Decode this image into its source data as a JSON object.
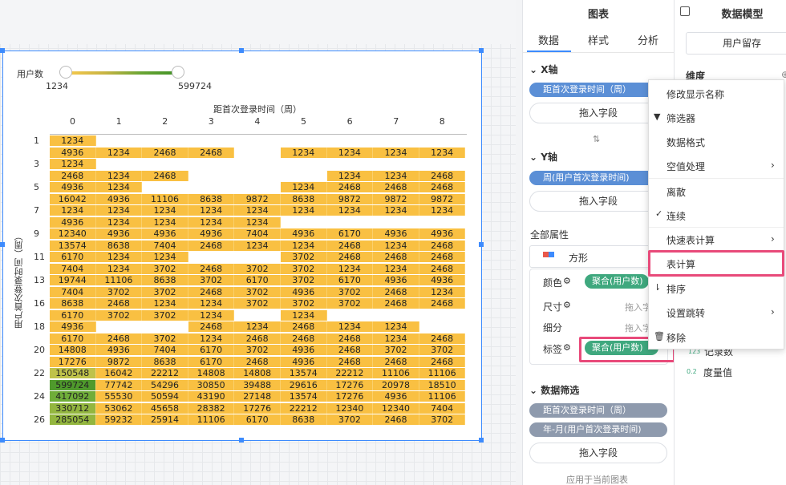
{
  "legend": {
    "title": "用户数",
    "min": "1234",
    "max": "599724"
  },
  "chart": {
    "x_title": "距首次登录时间（周）",
    "y_title": "用户首次登录时间（周）",
    "col_headers": [
      "0",
      "1",
      "2",
      "3",
      "4",
      "5",
      "6",
      "7",
      "8"
    ],
    "row_headers": [
      "1",
      "3",
      "5",
      "7",
      "9",
      "11",
      "13",
      "16",
      "18",
      "20",
      "22",
      "24",
      "26"
    ]
  },
  "chart_data": {
    "type": "heatmap",
    "columns": [
      "0",
      "1",
      "2",
      "3",
      "4",
      "5",
      "6",
      "7",
      "8"
    ],
    "rows": [
      [
        "1234",
        "",
        "",
        "",
        "",
        "",
        "",
        "",
        ""
      ],
      [
        "4936",
        "1234",
        "2468",
        "2468",
        "",
        "1234",
        "1234",
        "1234",
        "1234"
      ],
      [
        "1234",
        "",
        "",
        "",
        "",
        "",
        "",
        "",
        ""
      ],
      [
        "2468",
        "1234",
        "2468",
        "",
        "",
        "",
        "1234",
        "1234",
        "2468"
      ],
      [
        "4936",
        "1234",
        "",
        "",
        "",
        "1234",
        "2468",
        "2468",
        "2468"
      ],
      [
        "16042",
        "4936",
        "11106",
        "8638",
        "9872",
        "8638",
        "9872",
        "9872",
        "9872"
      ],
      [
        "1234",
        "1234",
        "1234",
        "1234",
        "1234",
        "1234",
        "1234",
        "1234",
        "1234"
      ],
      [
        "4936",
        "1234",
        "1234",
        "1234",
        "1234",
        "",
        "",
        "",
        ""
      ],
      [
        "12340",
        "4936",
        "4936",
        "4936",
        "7404",
        "4936",
        "6170",
        "4936",
        "4936"
      ],
      [
        "13574",
        "8638",
        "7404",
        "2468",
        "1234",
        "1234",
        "2468",
        "1234",
        "2468"
      ],
      [
        "6170",
        "1234",
        "1234",
        "",
        "",
        "3702",
        "2468",
        "2468",
        "2468"
      ],
      [
        "7404",
        "1234",
        "3702",
        "2468",
        "3702",
        "3702",
        "1234",
        "1234",
        "2468"
      ],
      [
        "19744",
        "11106",
        "8638",
        "3702",
        "6170",
        "3702",
        "6170",
        "4936",
        "4936"
      ],
      [
        "7404",
        "3702",
        "3702",
        "2468",
        "3702",
        "4936",
        "3702",
        "2468",
        "1234"
      ],
      [
        "8638",
        "2468",
        "1234",
        "1234",
        "3702",
        "3702",
        "3702",
        "2468",
        "2468"
      ],
      [
        "6170",
        "3702",
        "3702",
        "1234",
        "",
        "1234",
        "",
        "",
        ""
      ],
      [
        "4936",
        "",
        "",
        "2468",
        "1234",
        "2468",
        "1234",
        "1234",
        ""
      ],
      [
        "6170",
        "2468",
        "3702",
        "1234",
        "2468",
        "2468",
        "2468",
        "1234",
        "2468"
      ],
      [
        "14808",
        "4936",
        "7404",
        "6170",
        "3702",
        "4936",
        "2468",
        "3702",
        "3702"
      ],
      [
        "17276",
        "9872",
        "8638",
        "6170",
        "2468",
        "4936",
        "2468",
        "2468",
        "2468"
      ],
      [
        "150548",
        "16042",
        "22212",
        "14808",
        "14808",
        "13574",
        "22212",
        "11106",
        "11106"
      ],
      [
        "599724",
        "77742",
        "54296",
        "30850",
        "39488",
        "29616",
        "17276",
        "20978",
        "18510"
      ],
      [
        "417092",
        "55530",
        "50594",
        "43190",
        "27148",
        "13574",
        "17276",
        "4936",
        "11106"
      ],
      [
        "330712",
        "53062",
        "45658",
        "28382",
        "17276",
        "22212",
        "12340",
        "12340",
        "7404"
      ],
      [
        "285054",
        "59232",
        "25914",
        "11106",
        "6170",
        "8638",
        "3702",
        "2468",
        "3702"
      ]
    ],
    "color_range": [
      "#f9c042",
      "#3f9126"
    ]
  },
  "chart_panel": {
    "title": "图表",
    "tabs": [
      "数据",
      "样式",
      "分析"
    ],
    "x_axis": {
      "title": "X轴",
      "field": "距首次登录时间（周）",
      "drop": "拖入字段"
    },
    "y_axis": {
      "title": "Y轴",
      "field": "周(用户首次登录时间)",
      "drop": "拖入字段"
    },
    "attrs": {
      "title": "全部属性",
      "shape": "方形",
      "color_label": "颜色",
      "color_field": "聚合(用户数)",
      "size_label": "尺寸",
      "size_hint": "拖入字",
      "detail_label": "细分",
      "detail_hint": "拖入字",
      "tag_label": "标签",
      "tag_field": "聚合(用户数)"
    },
    "filter": {
      "title": "数据筛选",
      "f1": "距首次登录时间（周）",
      "f2": "年-月(用户首次登录时间)",
      "drop": "拖入字段",
      "apply": "应用于当前图表"
    }
  },
  "model_panel": {
    "title": "数据模型",
    "dataset": "用户留存",
    "dim_title": "维度",
    "record_count": "记录数",
    "measure": "度量值"
  },
  "menu": {
    "items": [
      "修改显示名称",
      "筛选器",
      "数据格式",
      "空值处理",
      "离散",
      "连续",
      "快速表计算",
      "表计算",
      "排序",
      "设置跳转",
      "移除"
    ]
  }
}
